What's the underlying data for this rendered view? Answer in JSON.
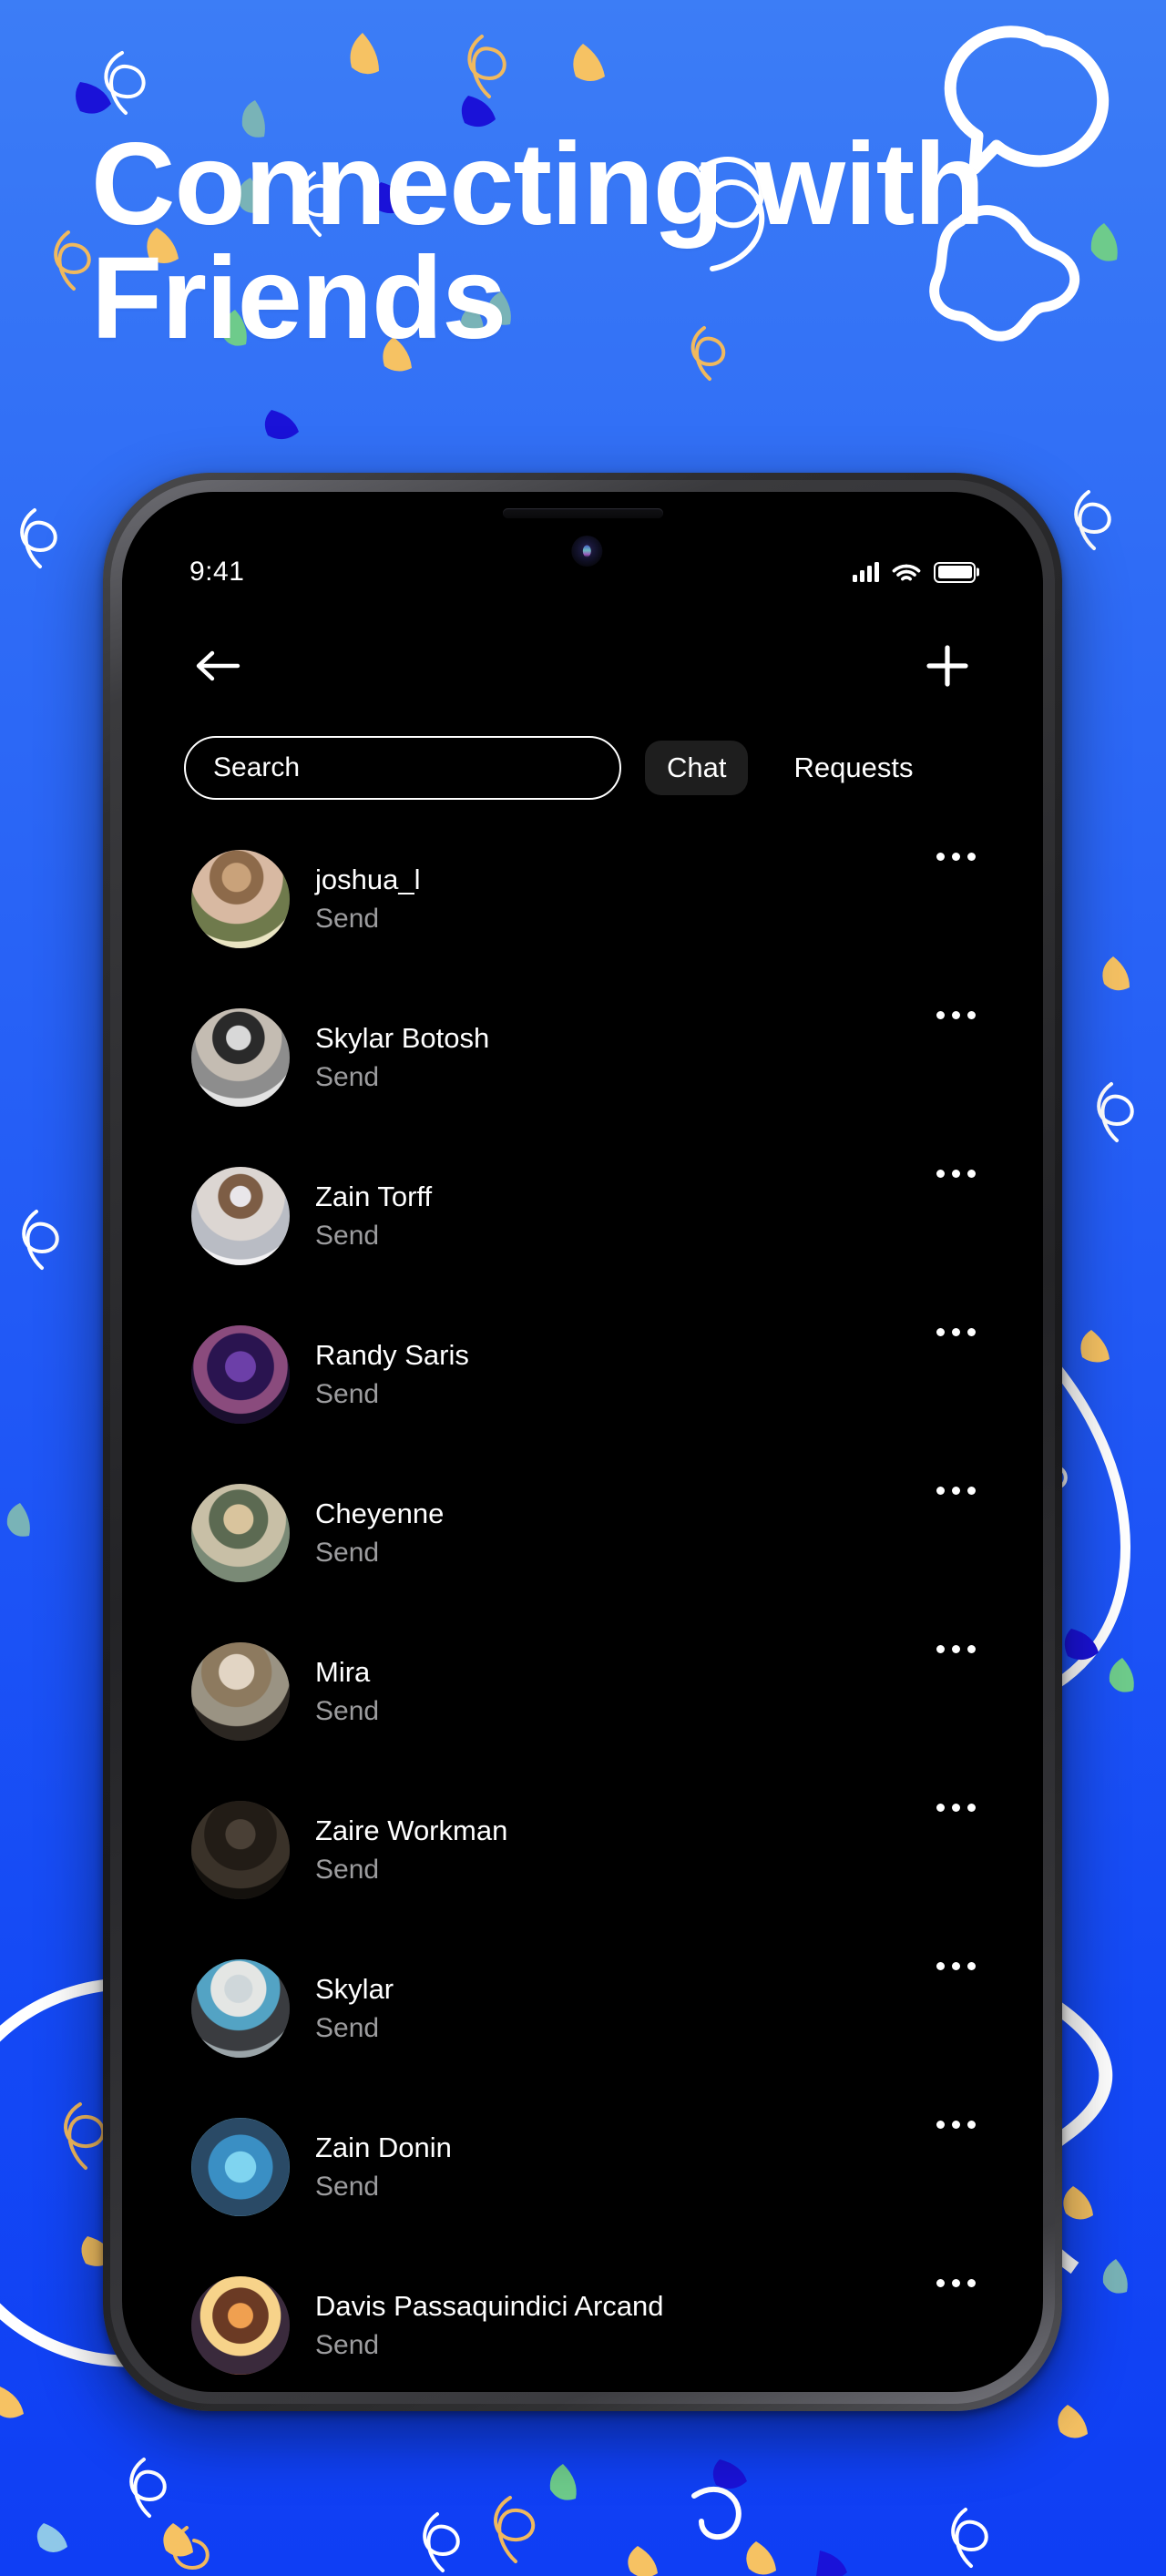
{
  "hero": {
    "line1": "Connecting with",
    "line2": "Friends"
  },
  "colors": {
    "background_blue_top": "#3c7df6",
    "background_blue_bottom": "#0f3ef4",
    "confetti_yellow": "#f6c263",
    "confetti_green": "#6ecb8b",
    "confetti_teal": "#79b3b7",
    "confetti_navy": "#1a12d8",
    "confetti_white": "#ffffff",
    "screen_black": "#000000",
    "tab_active_bg": "#1e1e1e",
    "subtitle_gray": "#9c9c9e"
  },
  "decor": {
    "chat_bubble_icon": "chat-bubble-outline",
    "blob_icon": "wavy-blob-outline",
    "circle_icon": "large-circle-outline"
  },
  "phone": {
    "status_bar": {
      "time": "9:41",
      "signal_icon": "cellular-signal-icon",
      "wifi_icon": "wifi-icon",
      "battery_icon": "battery-full-icon"
    },
    "top_nav": {
      "back_label": "back-arrow",
      "add_label": "plus"
    },
    "search": {
      "placeholder": "Search",
      "value": ""
    },
    "tabs": [
      {
        "label": "Chat",
        "active": true
      },
      {
        "label": "Requests",
        "active": false
      }
    ],
    "more_icon": "ellipsis-icon",
    "chat_list": [
      {
        "name": "joshua_l",
        "action": "Send",
        "avatar": "av1"
      },
      {
        "name": "Skylar Botosh",
        "action": "Send",
        "avatar": "av2"
      },
      {
        "name": "Zain Torff",
        "action": "Send",
        "avatar": "av3"
      },
      {
        "name": "Randy Saris",
        "action": "Send",
        "avatar": "av4"
      },
      {
        "name": "Cheyenne",
        "action": "Send",
        "avatar": "av5"
      },
      {
        "name": "Mira",
        "action": "Send",
        "avatar": "av6"
      },
      {
        "name": "Zaire Workman",
        "action": "Send",
        "avatar": "av7"
      },
      {
        "name": "Skylar",
        "action": "Send",
        "avatar": "av8"
      },
      {
        "name": "Zain Donin",
        "action": "Send",
        "avatar": "av9"
      },
      {
        "name": "Davis Passaquindici Arcand",
        "action": "Send",
        "avatar": "av10"
      }
    ]
  }
}
